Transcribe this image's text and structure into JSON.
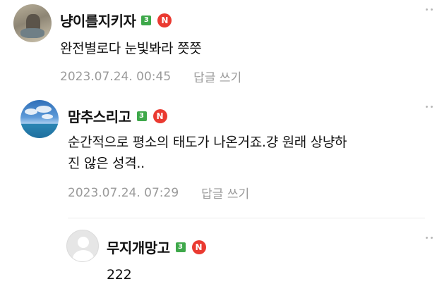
{
  "comments": [
    {
      "nickname": "냥이를지키자",
      "level": "3",
      "naver_badge": "N",
      "text": "완전별로다 눈빛봐라 쯧쯧",
      "timestamp": "2023.07.24. 00:45",
      "reply_label": "답글 쓰기"
    },
    {
      "nickname": "맘추스리고",
      "level": "3",
      "naver_badge": "N",
      "text_line1": "순간적으로 평소의 태도가 나온거죠.걍 원래 상냥하",
      "text_line2": "진 않은 성격..",
      "timestamp": "2023.07.24. 07:29",
      "reply_label": "답글 쓰기"
    },
    {
      "nickname": "무지개망고",
      "level": "3",
      "naver_badge": "N",
      "text": "222"
    }
  ],
  "colors": {
    "level_badge": "#3ea84a",
    "naver_badge": "#ea3a31",
    "meta_text": "#9a9a9a"
  },
  "icons": [
    "more-options-icon",
    "level-badge-icon",
    "naver-badge-icon",
    "avatar"
  ]
}
